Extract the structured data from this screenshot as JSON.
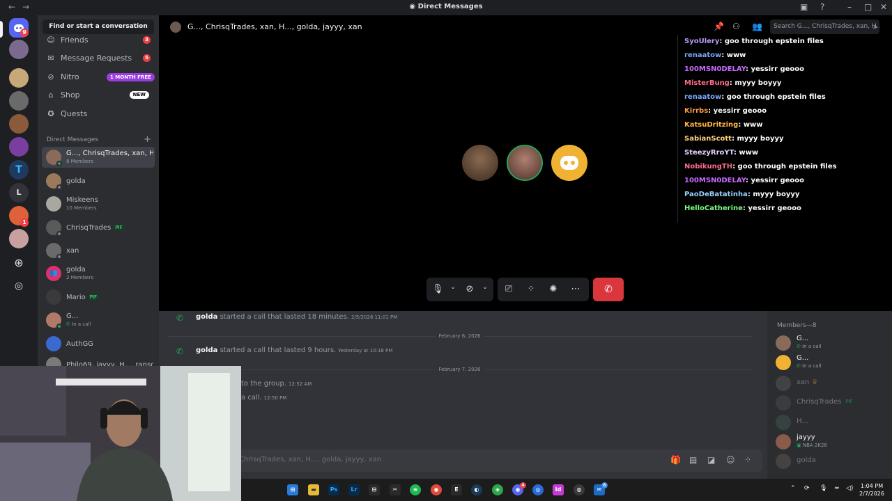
{
  "window": {
    "title": "Direct Messages"
  },
  "servers": [
    {
      "badge": "9"
    },
    {
      "badge": ""
    },
    {
      "badge": ""
    },
    {
      "badge": ""
    },
    {
      "badge": ""
    },
    {
      "badge": ""
    },
    {
      "badge": ""
    },
    {
      "badge": ""
    },
    {
      "badge": "1"
    },
    {
      "badge": ""
    }
  ],
  "server_text": {
    "letter_l": "L"
  },
  "sidebar": {
    "find": "Find or start a conversation",
    "nav": [
      {
        "label": "Friends",
        "count": "3"
      },
      {
        "label": "Message Requests",
        "count": "5"
      },
      {
        "label": "Nitro",
        "pill": "1 MONTH FREE"
      },
      {
        "label": "Shop",
        "pill": "NEW"
      },
      {
        "label": "Quests"
      }
    ],
    "dm_header": "Direct Messages",
    "dms": [
      {
        "name": "G..., ChrisqTrades, xan, H...",
        "sub": "8 Members"
      },
      {
        "name": "golda",
        "sub": ""
      },
      {
        "name": "Miskeens",
        "sub": "10 Members"
      },
      {
        "name": "ChrisqTrades",
        "sub": "",
        "tag": "PIF"
      },
      {
        "name": "xan",
        "sub": ""
      },
      {
        "name": "golda",
        "sub": "2 Members"
      },
      {
        "name": "Mario",
        "sub": "",
        "tag": "PIF"
      },
      {
        "name": "G...",
        "sub": "In a call"
      },
      {
        "name": "AuthGG",
        "sub": ""
      },
      {
        "name": "Philo69, jayyy, H..., ranso...",
        "sub": ""
      }
    ]
  },
  "call": {
    "title": "G..., ChrisqTrades, xan, H..., golda, jayyy, xan",
    "search_placeholder": "Search G..., ChrisqTrades, xan, H...",
    "end_call": "✆"
  },
  "overlay_chat": [
    {
      "user": "SyoUlery",
      "color": "#b99dff",
      "msg": "goo through epstein files"
    },
    {
      "user": "renaatow",
      "color": "#7aa7ff",
      "msg": "www"
    },
    {
      "user": "100MSN0DELAY",
      "color": "#c86bff",
      "msg": "yessirr geooo"
    },
    {
      "user": "MisterBung",
      "color": "#ff6b8a",
      "msg": "myyy boyyy"
    },
    {
      "user": "renaatow",
      "color": "#7aa7ff",
      "msg": "goo through epstein files"
    },
    {
      "user": "Kirrbs",
      "color": "#ff9a4a",
      "msg": "yessirr geooo"
    },
    {
      "user": "KatsuDritzing",
      "color": "#ffb347",
      "msg": "www"
    },
    {
      "user": "SabianScott",
      "color": "#ffd27a",
      "msg": "myyy boyyy"
    },
    {
      "user": "SteezyRroYT",
      "color": "#e6d6ff",
      "msg": "www"
    },
    {
      "user": "NobikungTH",
      "color": "#ff6b8a",
      "msg": "goo through epstein files"
    },
    {
      "user": "100MSN0DELAY",
      "color": "#c86bff",
      "msg": "yessirr geooo"
    },
    {
      "user": "PaoDeBatatinha",
      "color": "#9ad0ff",
      "msg": "myyy boyyy"
    },
    {
      "user": "HelloCatherine",
      "color": "#7dff7d",
      "msg": "yessirr geooo"
    }
  ],
  "messages": {
    "m1": {
      "user": "golda",
      "text": "started a call that lasted 18 minutes.",
      "time": "2/5/2026 11:01 PM"
    },
    "d1": "February 6, 2026",
    "m2": {
      "user": "golda",
      "text": "started a call that lasted 9 hours.",
      "time": "Yesterday at 10:18 PM"
    },
    "d2": "February 7, 2026",
    "m3": {
      "text": "to the group.",
      "time": "12:52 AM"
    },
    "m4": {
      "text": "a call.",
      "time": "12:50 PM"
    },
    "composer_placeholder": "ChrisqTrades, xan, H..., golda, jayyy, xan"
  },
  "members": {
    "header": "Members—8",
    "list": [
      {
        "name": "G...",
        "sub": "In a call"
      },
      {
        "name": "G...",
        "sub": "In a call"
      },
      {
        "name": "xan",
        "sub": ""
      },
      {
        "name": "ChrisqTrades",
        "sub": "",
        "tag": "PIF"
      },
      {
        "name": "H...",
        "sub": ""
      },
      {
        "name": "jayyy",
        "sub": "NBA 2K26"
      },
      {
        "name": "golda",
        "sub": ""
      }
    ]
  },
  "taskbar": {
    "time": "1:04 PM",
    "date": "2/7/2026",
    "badge_discord": "4",
    "badge_mail": "6"
  },
  "colors": {
    "accent": "#5865f2",
    "danger": "#da373c",
    "online": "#23a55a"
  }
}
